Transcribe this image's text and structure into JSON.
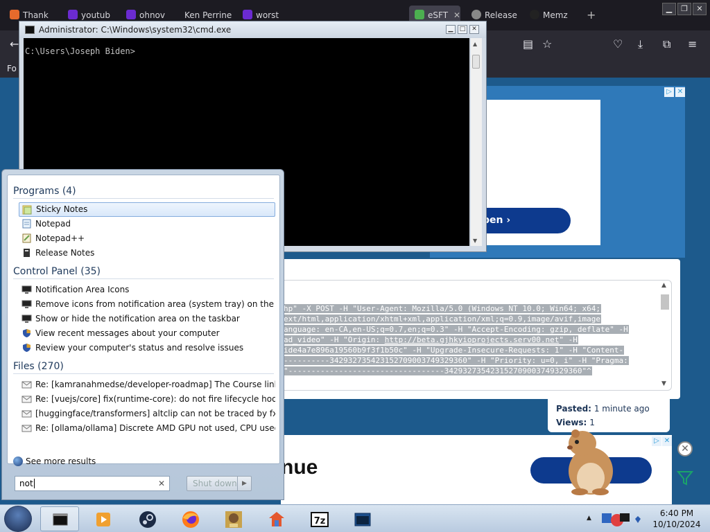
{
  "browser": {
    "tabs": [
      {
        "label": "Thank",
        "fav_color": "#e66a2c",
        "active": false
      },
      {
        "label": "youtub",
        "fav_color": "#6b2bd1",
        "active": false
      },
      {
        "label": "ohnov",
        "fav_color": "#6b2bd1",
        "active": false
      },
      {
        "label": "Ken Perrine",
        "fav_color": "",
        "active": false
      },
      {
        "label": "worst",
        "fav_color": "#6b2bd1",
        "active": false
      },
      {
        "label": "eSFT",
        "fav_color": "#4caf50",
        "active": true
      },
      {
        "label": "Release",
        "fav_color": "#888888",
        "active": false
      },
      {
        "label": "Memz",
        "fav_color": "#222222",
        "active": false
      }
    ],
    "bookmark_label": "Fo",
    "open_button_label": "pen",
    "ad_headline": "nue"
  },
  "paste": {
    "code_lines": [
      {
        "text": "hp\" -X POST -H \"User-Agent: Mozilla/5.0 (Windows NT 10.0; Win64; x64;"
      },
      {
        "text": "ext/html,application/xhtml+xml,application/xml;q=0.9,image/avif,image"
      },
      {
        "text": "anguage: en-CA,en-US;q=0.7,en;q=0.3\" -H \"Accept-Encoding: gzip, deflate\" -H"
      },
      {
        "pre": "ad_video\" -H \"Origin: ",
        "link": "http://beta.gjhkyioprojects.serv00.net",
        "post": "\" -H"
      },
      {
        "text": "ide4a7e896a19560b9f3f1b50c\" -H \"Upgrade-Insecure-Requests: 1\" -H \"Content-"
      },
      {
        "text": "----------342932735423152709003749329360\" -H \"Priority: u=0, i\" -H \"Pragma:"
      },
      {
        "text": "\"----------------------------------342932735423152709003749329360\"^"
      }
    ],
    "pasted_label": "Pasted:",
    "pasted_value": "1 minute ago",
    "views_label": "Views:",
    "views_value": "1"
  },
  "cmd": {
    "title": "Administrator: C:\\Windows\\system32\\cmd.exe",
    "prompt": "C:\\Users\\Joseph Biden>"
  },
  "start_menu": {
    "programs_header": "Programs (4)",
    "programs": [
      {
        "label": "Sticky Notes",
        "icon": "sticky-notes-icon",
        "selected": true
      },
      {
        "label": "Notepad",
        "icon": "notepad-icon",
        "selected": false
      },
      {
        "label": "Notepad++",
        "icon": "notepad-plus-plus-icon",
        "selected": false
      },
      {
        "label": "Release Notes",
        "icon": "release-notes-icon",
        "selected": false
      }
    ],
    "control_panel_header": "Control Panel (35)",
    "control_panel": [
      {
        "label": "Notification Area Icons",
        "icon": "monitor-icon"
      },
      {
        "label": "Remove icons from notification area (system tray) on the deskt...",
        "icon": "monitor-icon"
      },
      {
        "label": "Show or hide the notification area on the taskbar",
        "icon": "monitor-icon"
      },
      {
        "label": "View recent messages about your computer",
        "icon": "shield-icon"
      },
      {
        "label": "Review your computer's status and resolve issues",
        "icon": "shield-icon"
      }
    ],
    "files_header": "Files (270)",
    "files": [
      {
        "label": "Re: [kamranahmedse/developer-roadmap] The Course links are..."
      },
      {
        "label": "Re: [vuejs/core] fix(runtime-core): do not fire lifecycle hooks du..."
      },
      {
        "label": "[huggingface/transformers] altclip can not be traced by fx? (Iss..."
      },
      {
        "label": "Re: [ollama/ollama] Discrete AMD GPU not used, CPU used inst..."
      }
    ],
    "see_more": "See more results",
    "search_value": "not",
    "shutdown_label": "Shut down"
  },
  "taskbar": {
    "time": "6:40 PM",
    "date": "10/10/2024",
    "items": [
      "cmd-window",
      "media-player",
      "steam",
      "firefox",
      "box-app",
      "application",
      "7zip",
      "window"
    ]
  },
  "colors": {
    "page_bg": "#1d5a8c",
    "button_blue": "#0d3a8e",
    "selection_highlight": "#d9e8fa"
  }
}
